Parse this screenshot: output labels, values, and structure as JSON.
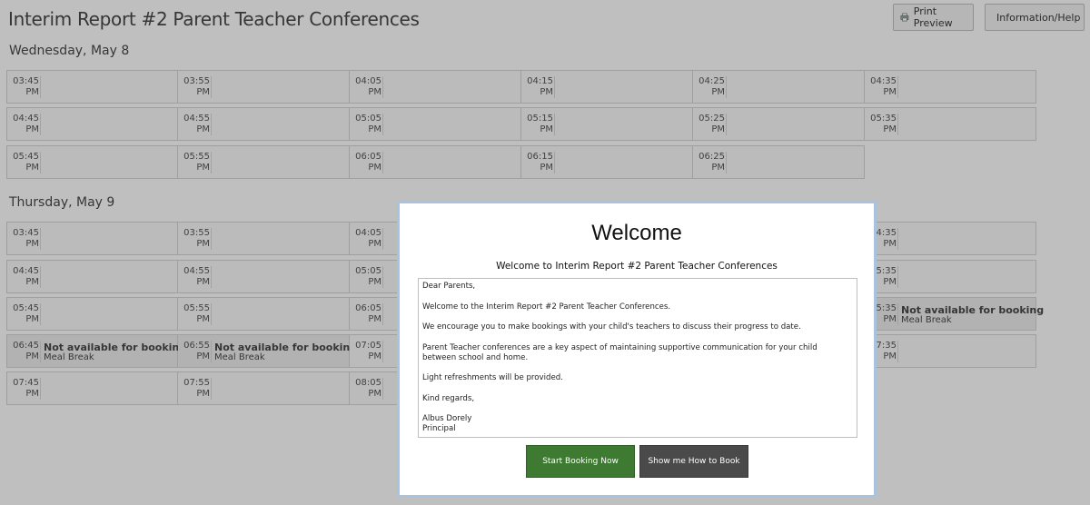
{
  "header": {
    "title": "Interim Report #2 Parent Teacher Conferences",
    "print_preview": "Print Preview",
    "info_help": "Information/Help"
  },
  "days": [
    {
      "label": "Wednesday, May 8",
      "rows": [
        [
          [
            "03:45",
            "PM"
          ],
          [
            "03:55",
            "PM"
          ],
          [
            "04:05",
            "PM"
          ],
          [
            "04:15",
            "PM"
          ],
          [
            "04:25",
            "PM"
          ],
          [
            "04:35",
            "PM"
          ]
        ],
        [
          [
            "04:45",
            "PM"
          ],
          [
            "04:55",
            "PM"
          ],
          [
            "05:05",
            "PM"
          ],
          [
            "05:15",
            "PM"
          ],
          [
            "05:25",
            "PM"
          ],
          [
            "05:35",
            "PM"
          ]
        ],
        [
          [
            "05:45",
            "PM"
          ],
          [
            "05:55",
            "PM"
          ],
          [
            "06:05",
            "PM"
          ],
          [
            "06:15",
            "PM"
          ],
          [
            "06:25",
            "PM"
          ]
        ]
      ]
    },
    {
      "label": "Thursday, May 9",
      "rows": [
        [
          [
            "03:45",
            "PM"
          ],
          [
            "03:55",
            "PM"
          ],
          [
            "04:05",
            "PM"
          ],
          [
            "",
            "",
            ""
          ],
          [
            "",
            "",
            ""
          ],
          [
            "4:35",
            "PM"
          ]
        ],
        [
          [
            "04:45",
            "PM"
          ],
          [
            "04:55",
            "PM"
          ],
          [
            "05:05",
            "PM"
          ],
          [
            "",
            "",
            ""
          ],
          [
            "",
            "",
            ""
          ],
          [
            "5:35",
            "PM"
          ]
        ],
        [
          [
            "05:45",
            "PM"
          ],
          [
            "05:55",
            "PM"
          ],
          [
            "06:05",
            "PM"
          ],
          [
            "",
            "",
            ""
          ],
          [
            "",
            "",
            ""
          ],
          [
            "5:35",
            "PM",
            "Not available for booking",
            "Meal Break"
          ]
        ],
        [
          [
            "06:45",
            "PM",
            "Not available for booking",
            "Meal Break"
          ],
          [
            "06:55",
            "PM",
            "Not available for booking",
            "Meal Break"
          ],
          [
            "07:05",
            "PM"
          ],
          [
            "",
            "",
            ""
          ],
          [
            "",
            "",
            ""
          ],
          [
            "7:35",
            "PM"
          ]
        ],
        [
          [
            "07:45",
            "PM"
          ],
          [
            "07:55",
            "PM"
          ],
          [
            "08:05",
            "PM"
          ]
        ]
      ]
    }
  ],
  "modal": {
    "title": "Welcome",
    "subtitle": "Welcome to Interim Report #2 Parent Teacher Conferences",
    "letter": [
      "Dear Parents,",
      "Welcome to the Interim Report #2 Parent Teacher Conferences.",
      "We encourage you to make bookings with your child's teachers to discuss their progress to date.",
      "Parent Teacher conferences are a key aspect of maintaining supportive communication for your child between school and home.",
      "Light refreshments will be provided.",
      "Kind regards,",
      "Albus Dorely",
      "Principal"
    ],
    "start_booking": "Start Booking Now",
    "show_me": "Show me How to Book"
  },
  "colors": {
    "green_button": "#3f7a32",
    "dark_button": "#4a4a4a",
    "modal_border": "#a9c3de"
  }
}
